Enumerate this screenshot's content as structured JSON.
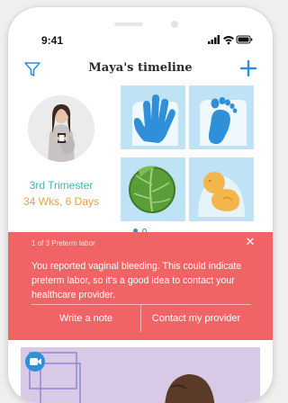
{
  "status_bar": {
    "time": "9:41"
  },
  "header": {
    "title": "Maya's timeline",
    "filter_icon": "filter-funnel-icon",
    "add_icon": "plus-icon"
  },
  "progress": {
    "trimester": "3rd Trimester",
    "weeks_days": "34 Wks, 6 Days"
  },
  "tiles": [
    {
      "icon": "handprint-icon"
    },
    {
      "icon": "footprint-icon"
    },
    {
      "icon": "cabbage-icon"
    },
    {
      "icon": "fetus-icon"
    }
  ],
  "carousel": {
    "page_count": 2,
    "current_page": 1
  },
  "alert": {
    "counter": "1 of 3 Preterm labor",
    "message": "You reported vaginal bleeding. This could indicate preterm labor, so it's a good idea to contact your healthcare provider.",
    "close_icon": "close-icon",
    "write_note_label": "Write a note",
    "contact_provider_label": "Contact my provider"
  },
  "colors": {
    "accent": "#2f8fd8",
    "alert_bg": "#f06466",
    "trimester_text": "#3fb8ad",
    "weeks_text": "#e9a13b",
    "tile_bg": "#bfe2f4"
  }
}
